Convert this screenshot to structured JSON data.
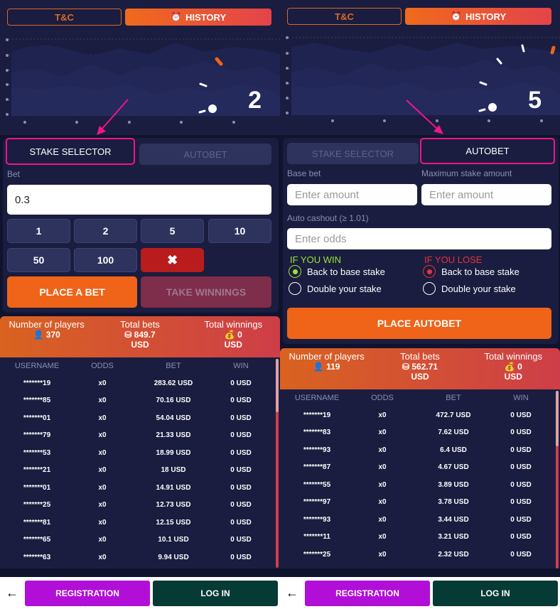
{
  "header": {
    "tc_label": "T&C",
    "history_label": "HISTORY",
    "history_icon": "alarm-clock-icon"
  },
  "colors": {
    "accent_orange": "#ef6418",
    "highlight_pink": "#f0158a",
    "win_green": "#9be13a",
    "lose_red": "#e8323a",
    "registration": "#b10fd8",
    "login": "#063a35"
  },
  "left": {
    "multiplier": "2",
    "tabs": {
      "stake_selector": "STAKE SELECTOR",
      "autobet": "AUTOBET"
    },
    "bet_label": "Bet",
    "bet_value": "0.3",
    "chips": [
      "1",
      "2",
      "5",
      "10",
      "50",
      "100"
    ],
    "clear_label": "✖",
    "place_bet": "PLACE A BET",
    "take_winnings": "TAKE WINNINGS",
    "stats": {
      "players_label": "Number of players",
      "players_value": "370",
      "bets_label": "Total bets",
      "bets_value": "849.7",
      "bets_currency": "USD",
      "winnings_label": "Total winnings",
      "winnings_value": "0",
      "winnings_currency": "USD"
    },
    "table": {
      "headers": [
        "USERNAME",
        "ODDS",
        "BET",
        "WIN"
      ],
      "rows": [
        [
          "*******19",
          "x0",
          "283.62 USD",
          "0 USD"
        ],
        [
          "*******85",
          "x0",
          "70.16 USD",
          "0 USD"
        ],
        [
          "*******01",
          "x0",
          "54.04 USD",
          "0 USD"
        ],
        [
          "*******79",
          "x0",
          "21.33 USD",
          "0 USD"
        ],
        [
          "*******53",
          "x0",
          "18.99 USD",
          "0 USD"
        ],
        [
          "*******21",
          "x0",
          "18 USD",
          "0 USD"
        ],
        [
          "*******01",
          "x0",
          "14.91 USD",
          "0 USD"
        ],
        [
          "*******25",
          "x0",
          "12.73 USD",
          "0 USD"
        ],
        [
          "*******81",
          "x0",
          "12.15 USD",
          "0 USD"
        ],
        [
          "*******65",
          "x0",
          "10.1 USD",
          "0 USD"
        ],
        [
          "*******63",
          "x0",
          "9.94 USD",
          "0 USD"
        ]
      ]
    }
  },
  "right": {
    "multiplier": "5",
    "tabs": {
      "stake_selector": "STAKE SELECTOR",
      "autobet": "AUTOBET"
    },
    "base_bet_label": "Base bet",
    "max_stake_label": "Maximum stake amount",
    "amount_placeholder": "Enter amount",
    "auto_cashout_label": "Auto cashout (≥ 1.01)",
    "odds_placeholder": "Enter odds",
    "if_win": "IF YOU WIN",
    "if_lose": "IF YOU LOSE",
    "back_to_base": "Back to base stake",
    "double_stake": "Double your stake",
    "place_autobet": "PLACE AUTOBET",
    "stats": {
      "players_label": "Number of players",
      "players_value": "119",
      "bets_label": "Total bets",
      "bets_value": "562.71",
      "bets_currency": "USD",
      "winnings_label": "Total winnings",
      "winnings_value": "0",
      "winnings_currency": "USD"
    },
    "table": {
      "headers": [
        "USERNAME",
        "ODDS",
        "BET",
        "WIN"
      ],
      "rows": [
        [
          "*******19",
          "x0",
          "472.7 USD",
          "0 USD"
        ],
        [
          "*******83",
          "x0",
          "7.62 USD",
          "0 USD"
        ],
        [
          "*******93",
          "x0",
          "6.4 USD",
          "0 USD"
        ],
        [
          "*******87",
          "x0",
          "4.67 USD",
          "0 USD"
        ],
        [
          "*******55",
          "x0",
          "3.89 USD",
          "0 USD"
        ],
        [
          "*******97",
          "x0",
          "3.78 USD",
          "0 USD"
        ],
        [
          "*******93",
          "x0",
          "3.44 USD",
          "0 USD"
        ],
        [
          "*******11",
          "x0",
          "3.21 USD",
          "0 USD"
        ],
        [
          "*******25",
          "x0",
          "2.32 USD",
          "0 USD"
        ]
      ]
    }
  },
  "footer": {
    "back_icon": "arrow-left-icon",
    "registration": "REGISTRATION",
    "login": "LOG IN"
  }
}
